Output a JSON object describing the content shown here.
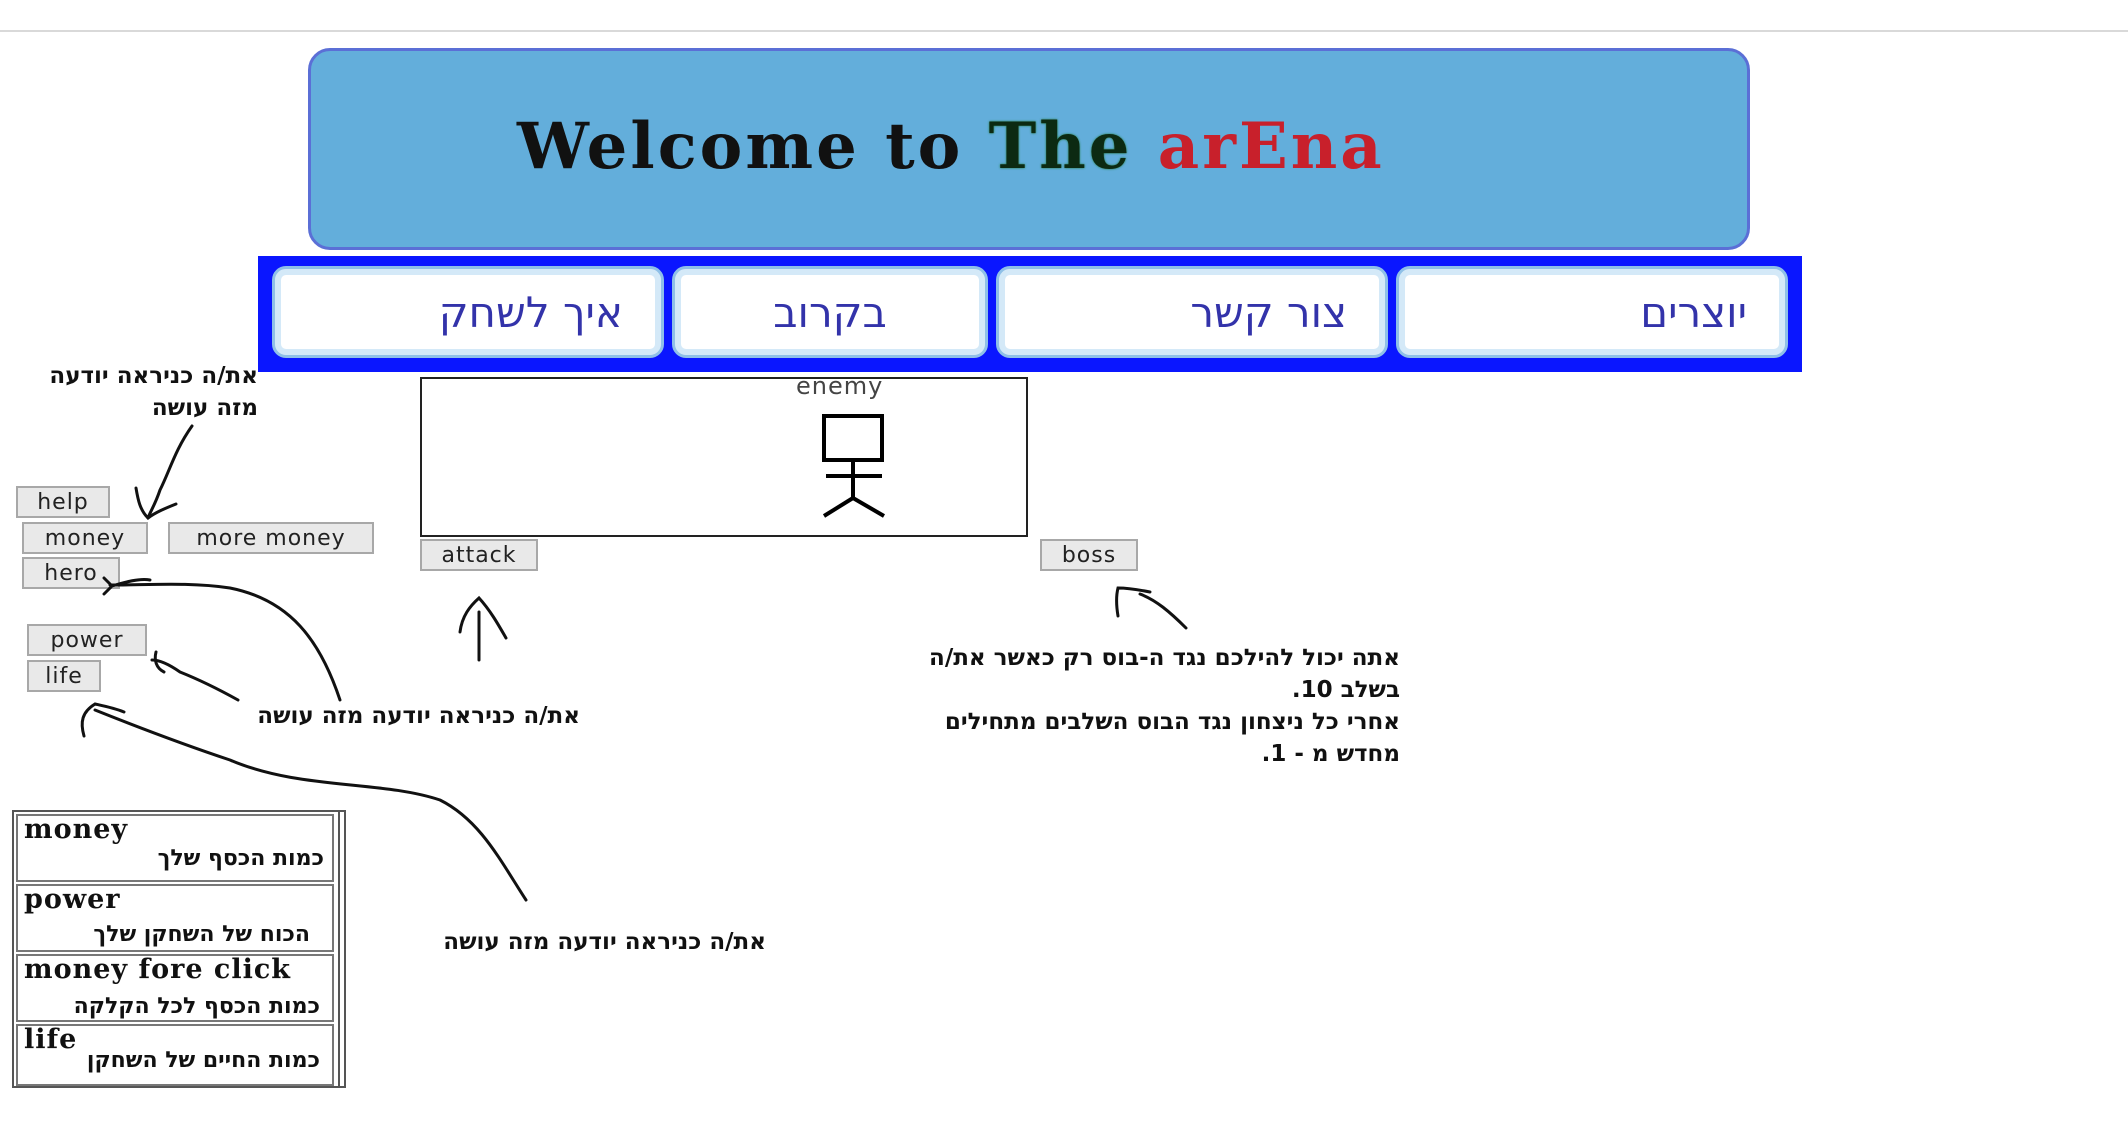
{
  "banner": {
    "prefix": "Welcome to ",
    "the": "The",
    "arena": "arEna"
  },
  "nav": [
    {
      "label": "איך לשחק"
    },
    {
      "label": "בקרוב"
    },
    {
      "label": "צור קשר"
    },
    {
      "label": "יוצרים"
    }
  ],
  "buttons": {
    "help": "help",
    "money": "money",
    "more_money": "more money",
    "hero": "hero",
    "power": "power",
    "life": "life",
    "attack": "attack",
    "boss": "boss"
  },
  "enemy": {
    "label": "enemy"
  },
  "notes": {
    "help_note": "את/ה כניראה יודעה\nמזה עושה",
    "hero_note": "את/ה כניראה יודעה מזה עושה",
    "life_note": "את/ה כניראה יודעה מזה עושה",
    "boss_note": "אתה יכול להילכם נגד ה-בוס רק כאשר את/ה\nבשלב 10.\nאחרי כל ניצחון נגד הבוס השלבים מתחילים\nמחדש מ - 1."
  },
  "stats": [
    {
      "title": "money",
      "desc": "כמות הכסף שלך"
    },
    {
      "title": "power",
      "desc": "הכוח של השחקן שלך"
    },
    {
      "title": "money fore click",
      "desc": "כמות הכסף לכל הקלקה"
    },
    {
      "title": "life",
      "desc": "כמות החיים של השחקן"
    }
  ],
  "colors": {
    "banner_bg": "#63aedb",
    "nav_bg": "#0a16ff",
    "nav_text": "#3333aa",
    "arena_red": "#c8202b"
  }
}
